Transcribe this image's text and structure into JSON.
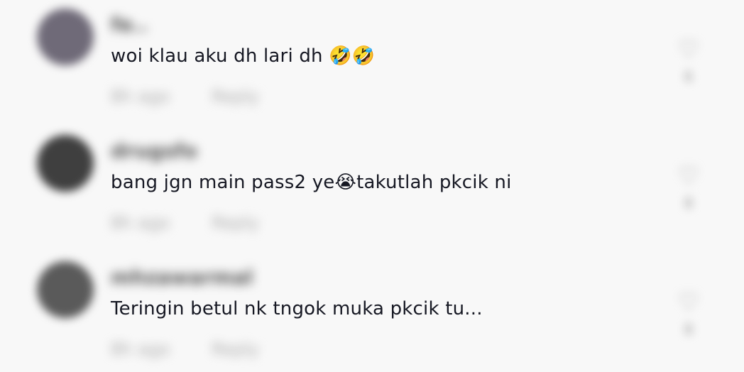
{
  "comments": [
    {
      "username": "fe..",
      "text": "woi klau aku dh lari dh 🤣🤣",
      "time": "8h ago",
      "reply_label": "Reply",
      "like_count": "6",
      "avatar_color": "#6f6a78"
    },
    {
      "username": "drugsfo",
      "text": "bang jgn main pass2 ye😭takutlah pkcik ni",
      "time": "8h ago",
      "reply_label": "Reply",
      "like_count": "8",
      "avatar_color": "#3f3f3f"
    },
    {
      "username": "mhzawarmal",
      "text": "Teringin betul nk tngok muka pkcik tu...",
      "time": "8h ago",
      "reply_label": "Reply",
      "like_count": "8",
      "avatar_color": "#5a5a5a"
    }
  ]
}
